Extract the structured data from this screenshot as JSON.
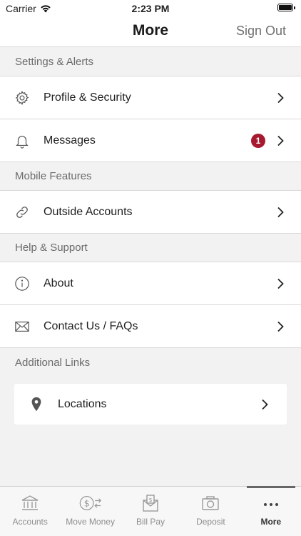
{
  "status_bar": {
    "carrier": "Carrier",
    "time": "2:23 PM"
  },
  "nav": {
    "title": "More",
    "sign_out": "Sign Out"
  },
  "sections": {
    "settings": {
      "header": "Settings & Alerts",
      "items": [
        {
          "label": "Profile & Security",
          "icon": "gear-icon"
        },
        {
          "label": "Messages",
          "icon": "bell-icon",
          "badge": "1"
        }
      ]
    },
    "mobile": {
      "header": "Mobile Features",
      "items": [
        {
          "label": "Outside Accounts",
          "icon": "link-icon"
        }
      ]
    },
    "help": {
      "header": "Help & Support",
      "items": [
        {
          "label": "About",
          "icon": "info-icon"
        },
        {
          "label": "Contact Us / FAQs",
          "icon": "envelope-icon"
        }
      ]
    },
    "additional": {
      "header": "Additional Links",
      "items": [
        {
          "label": "Locations",
          "icon": "map-pin-icon"
        }
      ]
    }
  },
  "tabs": [
    {
      "label": "Accounts",
      "icon": "bank-icon",
      "active": false
    },
    {
      "label": "Move Money",
      "icon": "money-transfer-icon",
      "active": false
    },
    {
      "label": "Bill Pay",
      "icon": "bill-icon",
      "active": false
    },
    {
      "label": "Deposit",
      "icon": "camera-icon",
      "active": false
    },
    {
      "label": "More",
      "icon": "more-dots-icon",
      "active": true
    }
  ],
  "colors": {
    "badge": "#a6192e",
    "text": "#1f1f1f",
    "muted": "#6b6b6b",
    "background": "#f2f2f2"
  }
}
